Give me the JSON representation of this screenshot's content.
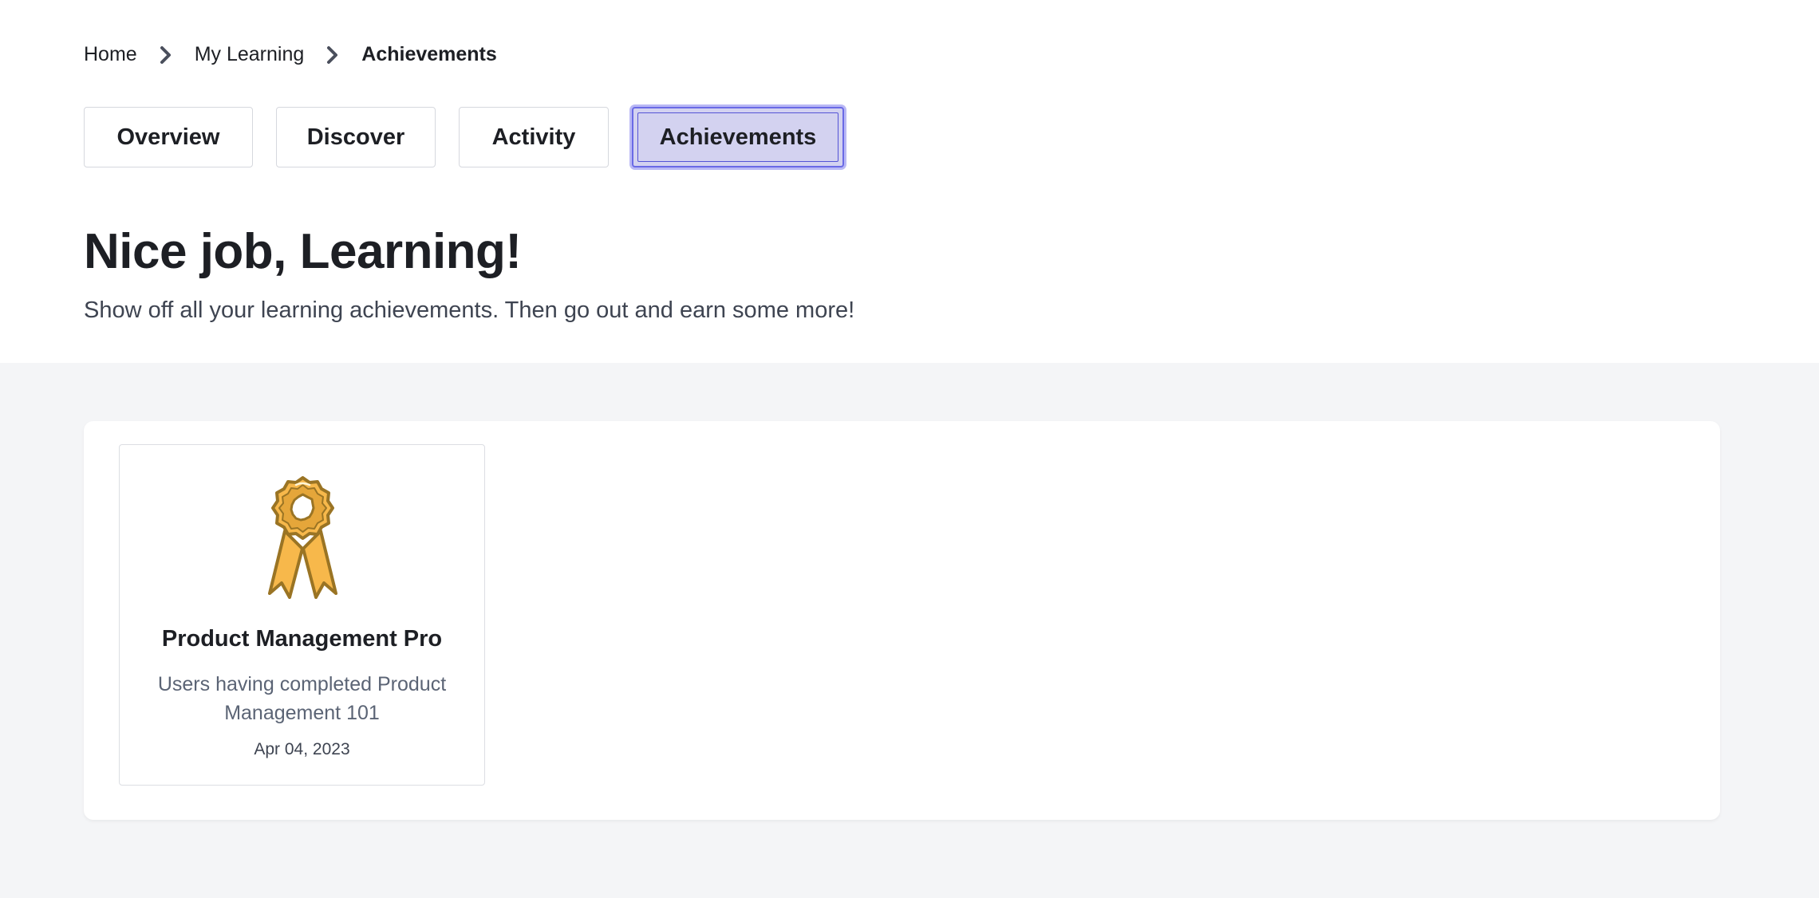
{
  "breadcrumb": {
    "items": [
      "Home",
      "My Learning",
      "Achievements"
    ]
  },
  "tabs": [
    {
      "label": "Overview",
      "active": false
    },
    {
      "label": "Discover",
      "active": false
    },
    {
      "label": "Activity",
      "active": false
    },
    {
      "label": "Achievements",
      "active": true
    }
  ],
  "header": {
    "title": "Nice job, Learning!",
    "subtitle": "Show off all your learning achievements. Then go out and earn some more!"
  },
  "achievements": [
    {
      "icon": "ribbon-badge-icon",
      "title": "Product Management Pro",
      "description": "Users having completed Product Management 101",
      "date": "Apr 04, 2023"
    }
  ],
  "colors": {
    "active_tab_bg": "#d3d2f0",
    "active_tab_border": "#6a6ae6",
    "badge_gold": "#f7b84b",
    "badge_outline": "#9a7424",
    "page_bg": "#f4f5f7"
  }
}
